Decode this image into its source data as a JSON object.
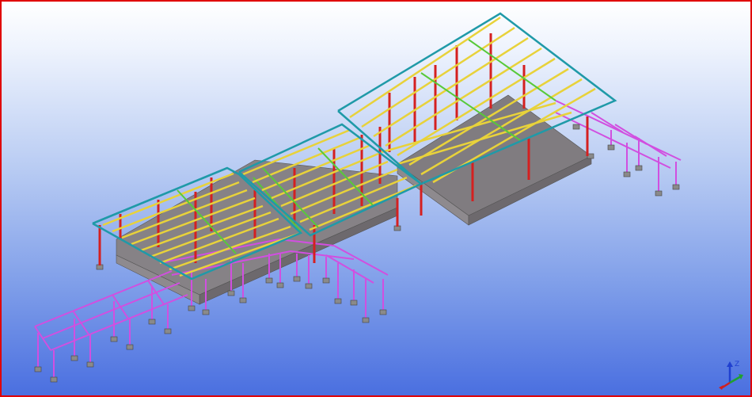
{
  "viewport": {
    "type": "3d-structural-model-view",
    "frame_color": "#e00000",
    "background": {
      "top": "#ffffff",
      "bottom": "#4a6fe0"
    }
  },
  "model": {
    "slab_color": "#7f7d7f",
    "column_color": "#d42020",
    "roof_edge_color": "#1f9aa8",
    "purlin_color": "#e8d23a",
    "rafter_color": "#58c93a",
    "canopy_color": "#d14fe0",
    "footing_color": "#8a8a8a"
  },
  "axis_triad": {
    "icon": "xyz-axis-triad-icon",
    "z_label": "Z",
    "x_color": "#d02020",
    "y_color": "#20a030",
    "z_color": "#2040d0"
  }
}
